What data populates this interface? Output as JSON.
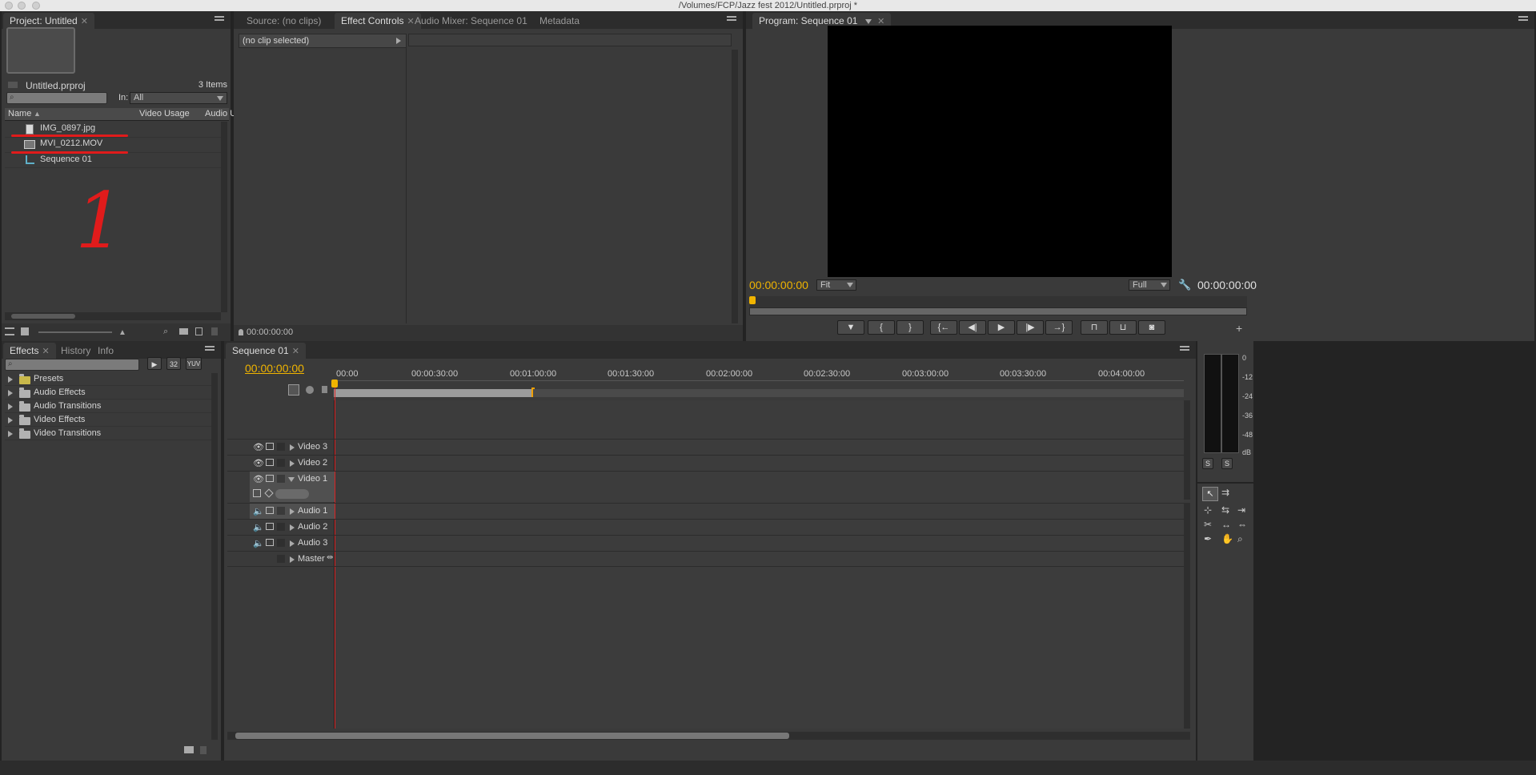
{
  "window": {
    "title": "/Volumes/FCP/Jazz fest 2012/Untitled.prproj *"
  },
  "project_panel": {
    "tab_label": "Project: Untitled",
    "project_file": "Untitled.prproj",
    "item_count": "3 Items",
    "in_label": "In:",
    "in_value": "All",
    "columns": [
      "Name",
      "Video Usage",
      "Audio U"
    ],
    "items": [
      {
        "name": "IMG_0897.jpg",
        "icon": "image-file-icon"
      },
      {
        "name": "MVI_0212.MOV",
        "icon": "movie-file-icon"
      },
      {
        "name": "Sequence 01",
        "icon": "sequence-icon"
      }
    ],
    "annotation_number": "1"
  },
  "source_panel": {
    "tabs": [
      "Source: (no clips)",
      "Effect Controls",
      "Audio Mixer: Sequence 01",
      "Metadata"
    ],
    "active_tab": "Effect Controls",
    "no_clip_label": "(no clip selected)",
    "timecode": "00:00:00:00"
  },
  "program_panel": {
    "tab_label": "Program: Sequence 01",
    "timecode_left": "00:00:00:00",
    "timecode_right": "00:00:00:00",
    "zoom_value": "Fit",
    "quality_value": "Full"
  },
  "effects_panel": {
    "tabs": [
      "Effects",
      "History",
      "Info"
    ],
    "active_tab": "Effects",
    "badges": [
      "32",
      "YUV"
    ],
    "folders": [
      "Presets",
      "Audio Effects",
      "Audio Transitions",
      "Video Effects",
      "Video Transitions"
    ]
  },
  "timeline_panel": {
    "tab_label": "Sequence 01",
    "timecode": "00:00:00:00",
    "ruler": [
      "00:00",
      "00:00:30:00",
      "00:01:00:00",
      "00:01:30:00",
      "00:02:00:00",
      "00:02:30:00",
      "00:03:00:00",
      "00:03:30:00",
      "00:04:00:00"
    ],
    "video_tracks": [
      "Video 3",
      "Video 2",
      "Video 1"
    ],
    "audio_tracks": [
      "Audio 1",
      "Audio 2",
      "Audio 3"
    ],
    "master_label": "Master"
  },
  "audio_meter": {
    "scale": [
      "0",
      "-12",
      "-24",
      "-36",
      "-48",
      "dB"
    ],
    "solo_buttons": [
      "S",
      "S"
    ]
  },
  "colors": {
    "accent_timecode": "#f0b400",
    "annotation_red": "#e01b1b",
    "playhead": "#d22"
  }
}
